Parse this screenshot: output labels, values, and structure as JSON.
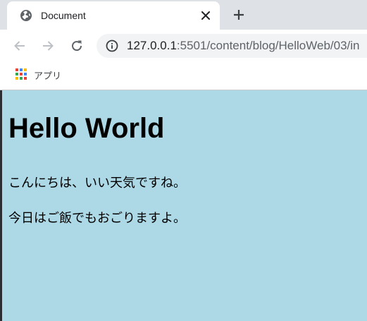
{
  "tab": {
    "title": "Document",
    "favicon": "globe-icon",
    "close_icon": "close-icon",
    "new_tab_icon": "plus-icon"
  },
  "toolbar": {
    "back_icon": "arrow-left-icon",
    "forward_icon": "arrow-right-icon",
    "reload_icon": "reload-icon",
    "site_info_icon": "info-icon",
    "url_host": "127.0.0.1",
    "url_rest": ":5501/content/blog/HelloWeb/03/in"
  },
  "bookmarks": {
    "apps_icon": "apps-grid-icon",
    "apps_label": "アプリ"
  },
  "page": {
    "background": "#add8e6",
    "heading": "Hello World",
    "paragraphs": [
      "こんにちは、いい天気ですね。",
      "今日はご飯でもおごりますよ。"
    ]
  }
}
